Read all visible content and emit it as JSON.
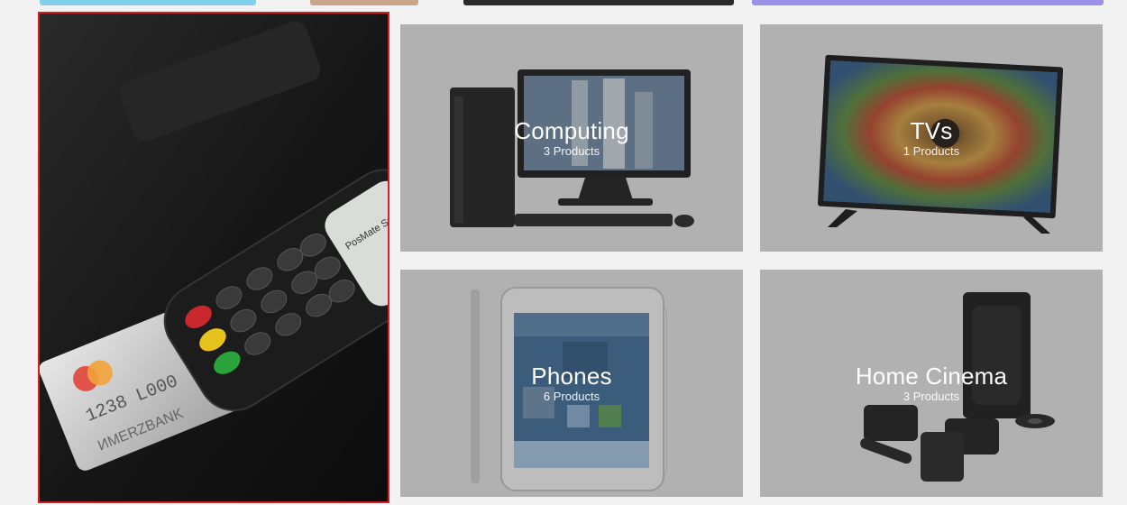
{
  "categories": [
    {
      "id": "computing",
      "title": "Computing",
      "count": "3 Products"
    },
    {
      "id": "tvs",
      "title": "TVs",
      "count": "1 Products"
    },
    {
      "id": "phones",
      "title": "Phones",
      "count": "6 Products"
    },
    {
      "id": "cinema",
      "title": "Home Cinema",
      "count": "3 Products"
    }
  ],
  "promo": {
    "card_brand": "MasterCard",
    "card_number": "1238 L000",
    "card_bank": "ИМЕRZBANK",
    "terminal_label": "PosMate Smart"
  },
  "colors": {
    "highlight_border": "#d11f24",
    "page_background": "#f2f2f2",
    "tile_shade": "rgba(60,60,60,0.32)"
  }
}
